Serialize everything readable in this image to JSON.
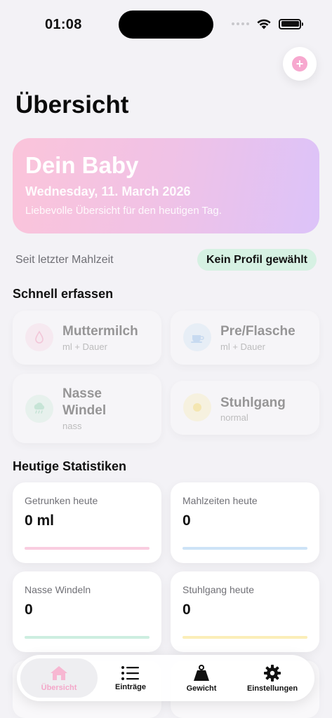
{
  "status": {
    "time": "01:08"
  },
  "page": {
    "title": "Übersicht"
  },
  "hero": {
    "title": "Dein Baby",
    "date": "Wednesday, 11. March 2026",
    "subtitle": "Liebevolle Übersicht für den heutigen Tag."
  },
  "info": {
    "since_label": "Seit letzter Mahlzeit",
    "profile_badge": "Kein Profil gewählt"
  },
  "quick": {
    "title": "Schnell erfassen",
    "items": [
      {
        "label": "Muttermilch",
        "sub": "ml + Dauer",
        "icon": "drop-icon"
      },
      {
        "label": "Pre/Flasche",
        "sub": "ml + Dauer",
        "icon": "cup-icon"
      },
      {
        "label": "Nasse Windel",
        "line1": "Nasse",
        "line2": "Windel",
        "sub": "nass",
        "icon": "rain-cloud-icon"
      },
      {
        "label": "Stuhlgang",
        "sub": "normal",
        "icon": "sun-icon"
      }
    ]
  },
  "stats": {
    "title": "Heutige Statistiken",
    "items": [
      {
        "label": "Getrunken heute",
        "value": "0 ml",
        "color": "#f9cde0"
      },
      {
        "label": "Mahlzeiten heute",
        "value": "0",
        "color": "#cde3f7"
      },
      {
        "label": "Nasse Windeln",
        "value": "0",
        "color": "#cdeee0"
      },
      {
        "label": "Stuhlgang heute",
        "value": "0",
        "color": "#fbeeb8"
      }
    ]
  },
  "tabs": [
    {
      "label": "Übersicht",
      "icon": "house-icon",
      "active": true
    },
    {
      "label": "Einträge",
      "icon": "list-icon",
      "active": false
    },
    {
      "label": "Gewicht",
      "icon": "scale-weight-icon",
      "active": false
    },
    {
      "label": "Einstellungen",
      "icon": "gear-icon",
      "active": false
    }
  ],
  "colors": {
    "accent_pink": "#f4a7c9",
    "badge_green": "#d6f1e3",
    "background": "#f3f2f6"
  }
}
